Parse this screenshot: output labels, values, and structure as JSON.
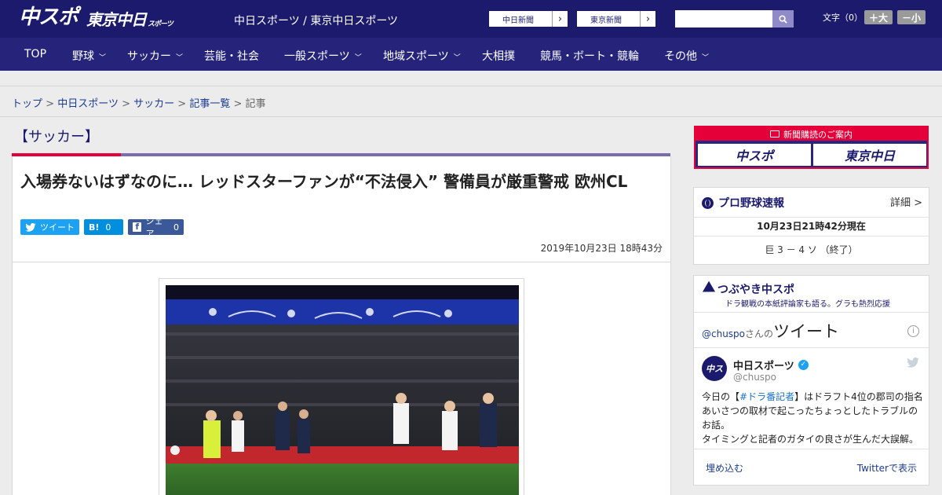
{
  "header": {
    "logo_chunichi": "中スポ",
    "logo_tokyo": "東京中日",
    "logo_tokyo_small": "スポーツ",
    "site_names": "中日スポーツ / 東京中日スポーツ",
    "paper_buttons": [
      "中日新聞",
      "東京新聞"
    ],
    "search": {
      "placeholder": ""
    },
    "font_size_label": "文字（0）",
    "font_larger": "＋大",
    "font_smaller": "－小"
  },
  "nav": {
    "items": [
      {
        "label": "TOP",
        "dropdown": false
      },
      {
        "label": "野球",
        "dropdown": true
      },
      {
        "label": "サッカー",
        "dropdown": true
      },
      {
        "label": "芸能・社会",
        "dropdown": false
      },
      {
        "label": "一般スポーツ",
        "dropdown": true
      },
      {
        "label": "地域スポーツ",
        "dropdown": true
      },
      {
        "label": "大相撲",
        "dropdown": false
      },
      {
        "label": "競馬・ボート・競輪",
        "dropdown": false
      },
      {
        "label": "その他",
        "dropdown": true
      }
    ]
  },
  "breadcrumb": {
    "items": [
      "トップ",
      "中日スポーツ",
      "サッカー",
      "記事一覧"
    ],
    "current": "記事",
    "sep": ">"
  },
  "article": {
    "category": "【サッカー】",
    "headline": "入場券ないはずなのに… レッドスターファンが“不法侵入” 警備員が厳重警戒 欧州CL",
    "tweet_label": "ツイート",
    "hatena_label": "B!",
    "hatena_count": "0",
    "share_label": "シェア",
    "share_count": "0",
    "date": "2019年10月23日 18時43分"
  },
  "sidebar": {
    "banner_title": "新聞購読のご案内",
    "banner_left": "中スポ",
    "banner_right": "東京中日",
    "baseball": {
      "title": "プロ野球速報",
      "detail_link": "詳細 >",
      "updated": "10月23日21時42分現在",
      "score": "巨 3 － 4 ソ （終了）"
    },
    "tweets": {
      "title": "つぶやき中スポ",
      "subtitle": "ドラ観戦の本紙評論家も語る。グラも熱烈応援",
      "handle_prefix": "@chuspo",
      "handle_suffix": "さんの",
      "tweet_word": "ツイート",
      "account_name": "中日スポーツ",
      "account_handle": "@chuspo",
      "text_prefix": "今日の【",
      "hashtag": "#ドラ番記者",
      "text_rest": "】はドラフト4位の郡司の指名あいさつの取材で起こったちょっとしたトラブルのお話。",
      "text_line2": "タイミングと記者のガタイの良さが生んだ大誤解。",
      "embed_link": "埋め込む",
      "view_link": "Twitterで表示"
    }
  },
  "colors": {
    "header_bg": "#1b1a6c",
    "nav_bg": "#26247a",
    "accent_red": "#e60039",
    "accent_purple": "#7d6bb0",
    "twitter_blue": "#1da1f2"
  }
}
